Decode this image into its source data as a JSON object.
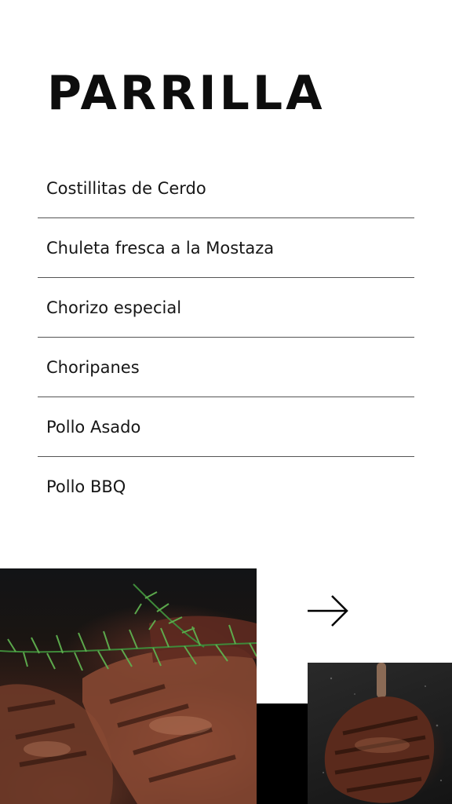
{
  "header": {
    "title": "PARRILLA"
  },
  "menu": {
    "items": [
      {
        "label": "Costillitas de Cerdo"
      },
      {
        "label": "Chuleta fresca a la Mostaza"
      },
      {
        "label": "Chorizo especial"
      },
      {
        "label": "Choripanes"
      },
      {
        "label": "Pollo Asado"
      },
      {
        "label": "Pollo BBQ"
      }
    ]
  },
  "navigation": {
    "next_icon": "arrow-right-icon"
  },
  "images": {
    "main": "grilled-steak-with-rosemary-photo",
    "secondary": "tomahawk-steak-photo"
  },
  "colors": {
    "background": "#ffffff",
    "text": "#111111",
    "divider": "#555555",
    "accent_block": "#000000"
  }
}
